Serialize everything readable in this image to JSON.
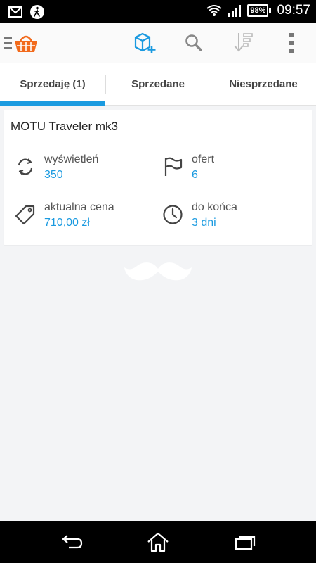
{
  "status_bar": {
    "time": "09:57",
    "battery": "98%",
    "icons": [
      "gmail-icon",
      "accessibility-icon",
      "wifi-icon",
      "signal-icon",
      "battery-icon"
    ]
  },
  "action_bar": {
    "icons": [
      "menu-icon",
      "basket-logo-icon",
      "new-listing-icon",
      "search-icon",
      "sort-icon",
      "overflow-menu-icon"
    ],
    "accent_color": "#f26a1b",
    "icon_blue": "#1a9ae0"
  },
  "tabs": [
    {
      "label": "Sprzedaję (1)",
      "active": true
    },
    {
      "label": "Sprzedane",
      "active": false
    },
    {
      "label": "Niesprzedane",
      "active": false
    }
  ],
  "listing": {
    "title": "MOTU Traveler mk3",
    "views": {
      "label": "wyświetleń",
      "value": "350",
      "icon": "refresh-icon"
    },
    "offers": {
      "label": "ofert",
      "value": "6",
      "icon": "flag-icon"
    },
    "price": {
      "label": "aktualna cena",
      "value": "710,00 zł",
      "icon": "price-tag-icon"
    },
    "ends": {
      "label": "do końca",
      "value": "3 dni",
      "icon": "clock-icon"
    }
  },
  "nav_bar": {
    "icons": [
      "back-icon",
      "home-icon",
      "recent-apps-icon"
    ]
  }
}
